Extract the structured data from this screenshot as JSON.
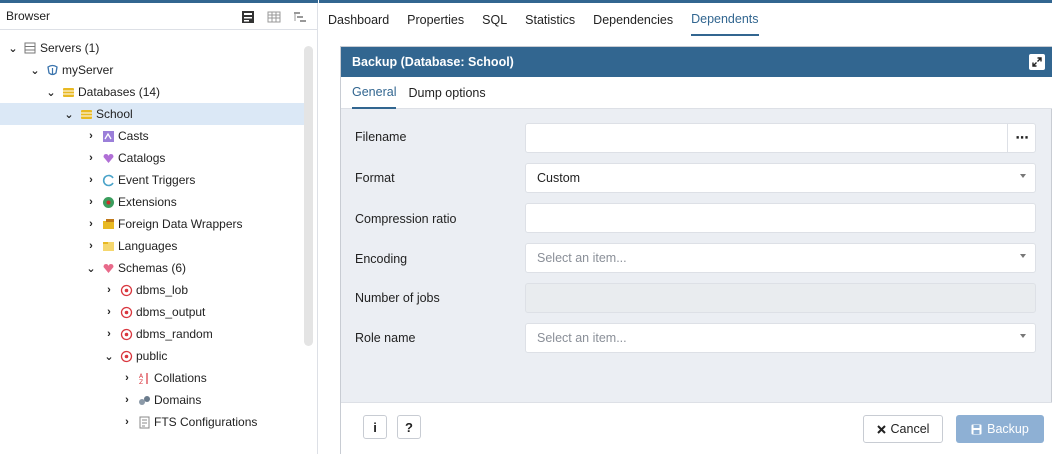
{
  "browser": {
    "title": "Browser"
  },
  "tree": {
    "servers": "Servers (1)",
    "my_server": "myServer",
    "databases": "Databases (14)",
    "school": "School",
    "casts": "Casts",
    "catalogs": "Catalogs",
    "event_triggers": "Event Triggers",
    "extensions": "Extensions",
    "foreign_data_wrappers": "Foreign Data Wrappers",
    "languages": "Languages",
    "schemas": "Schemas (6)",
    "dbms_lob": "dbms_lob",
    "dbms_output": "dbms_output",
    "dbms_random": "dbms_random",
    "public": "public",
    "collations": "Collations",
    "domains": "Domains",
    "fts_configurations": "FTS Configurations"
  },
  "top_tabs": {
    "dashboard": "Dashboard",
    "properties": "Properties",
    "sql": "SQL",
    "statistics": "Statistics",
    "dependencies": "Dependencies",
    "dependents": "Dependents"
  },
  "dialog": {
    "title": "Backup (Database: School)",
    "tabs": {
      "general": "General",
      "dump_options": "Dump options"
    },
    "form": {
      "filename_label": "Filename",
      "filename_value": "",
      "format_label": "Format",
      "format_value": "Custom",
      "compression_label": "Compression ratio",
      "compression_value": "",
      "encoding_label": "Encoding",
      "encoding_placeholder": "Select an item...",
      "jobs_label": "Number of jobs",
      "jobs_value": "",
      "role_label": "Role name",
      "role_placeholder": "Select an item..."
    },
    "footer": {
      "info_label": "i",
      "help_label": "?",
      "cancel_label": "Cancel",
      "backup_label": "Backup"
    }
  },
  "colors": {
    "accent": "#326690",
    "selected_row": "#dbe8f6",
    "dialog_bg": "#ebeef3",
    "backup_disabled": "#8eb0d4"
  }
}
